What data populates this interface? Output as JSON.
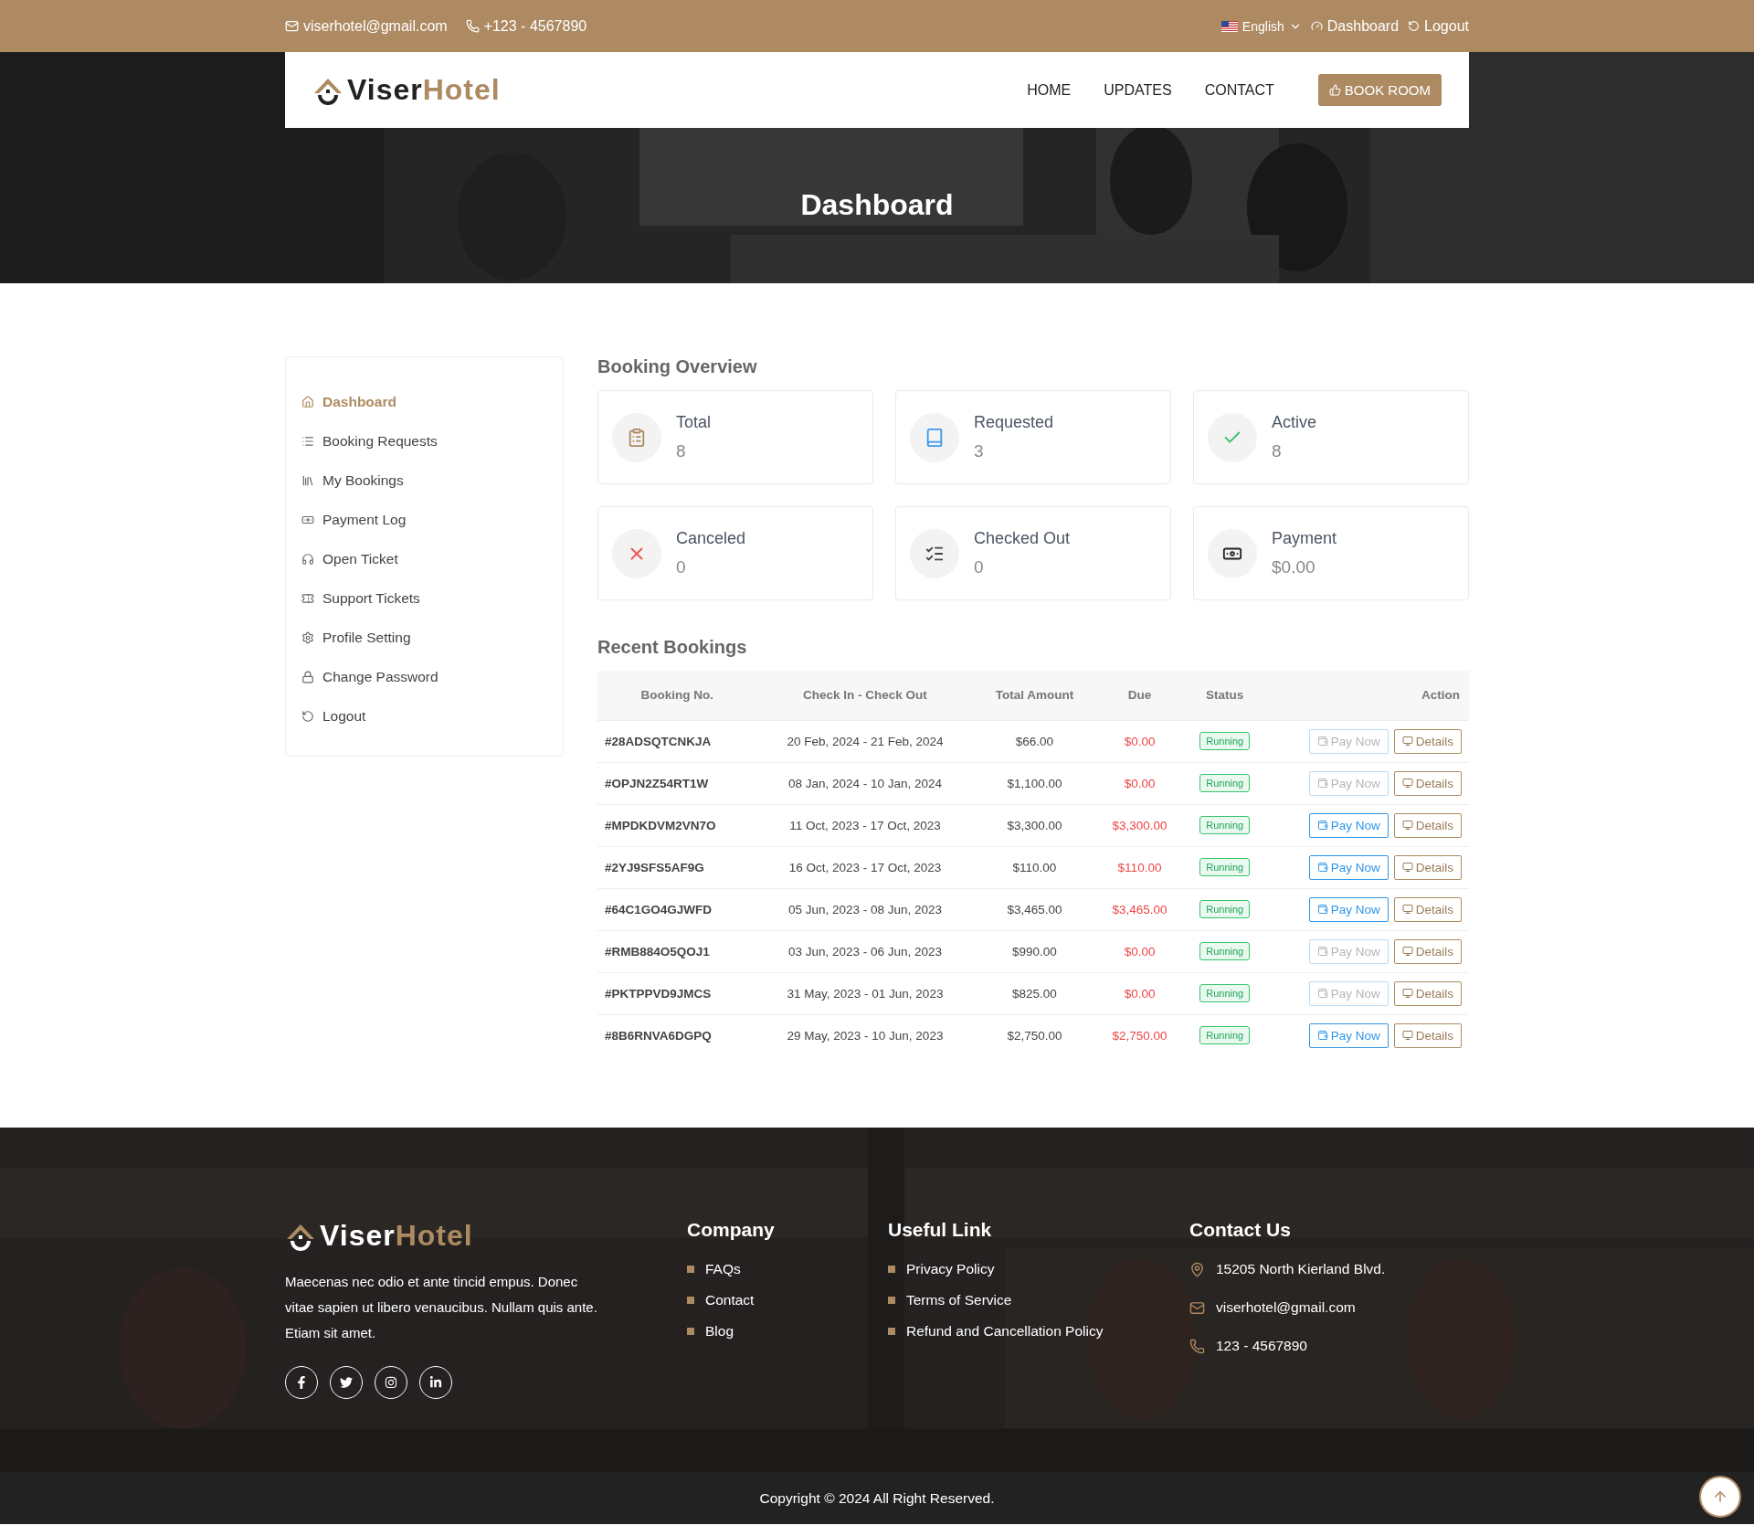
{
  "top_bar": {
    "email": "viserhotel@gmail.com",
    "phone": "+123 - 4567890",
    "language": "English",
    "dashboard_link": "Dashboard",
    "logout_link": "Logout"
  },
  "header": {
    "logo": {
      "first": "Viser",
      "second": "Hotel"
    },
    "nav": [
      "HOME",
      "UPDATES",
      "CONTACT"
    ],
    "book_button": "BOOK ROOM"
  },
  "hero": {
    "title": "Dashboard"
  },
  "sidebar": {
    "items": [
      {
        "label": "Dashboard",
        "selected": true
      },
      {
        "label": "Booking Requests",
        "selected": false
      },
      {
        "label": "My Bookings",
        "selected": false
      },
      {
        "label": "Payment Log",
        "selected": false
      },
      {
        "label": "Open Ticket",
        "selected": false
      },
      {
        "label": "Support Tickets",
        "selected": false
      },
      {
        "label": "Profile Setting",
        "selected": false
      },
      {
        "label": "Change Password",
        "selected": false
      },
      {
        "label": "Logout",
        "selected": false
      }
    ]
  },
  "booking_overview": {
    "title": "Booking Overview",
    "cards": [
      {
        "label": "Total",
        "value": "8"
      },
      {
        "label": "Requested",
        "value": "3"
      },
      {
        "label": "Active",
        "value": "8"
      },
      {
        "label": "Canceled",
        "value": "0"
      },
      {
        "label": "Checked Out",
        "value": "0"
      },
      {
        "label": "Payment",
        "value": "$0.00"
      }
    ]
  },
  "recent_bookings": {
    "title": "Recent Bookings",
    "columns": [
      "Booking No.",
      "Check In - Check Out",
      "Total Amount",
      "Due",
      "Status",
      "Action"
    ],
    "rows": [
      {
        "booking_no": "#28ADSQTCNKJA",
        "dates": "20 Feb, 2024 - 21 Feb, 2024",
        "total": "$66.00",
        "due": "$0.00",
        "status": "Running",
        "pay_button": {
          "label": "Pay Now",
          "disabled": true
        },
        "details_button": "Details"
      },
      {
        "booking_no": "#OPJN2Z54RT1W",
        "dates": "08 Jan, 2024 - 10 Jan, 2024",
        "total": "$1,100.00",
        "due": "$0.00",
        "status": "Running",
        "pay_button": {
          "label": "Pay Now",
          "disabled": true
        },
        "details_button": "Details"
      },
      {
        "booking_no": "#MPDKDVM2VN7O",
        "dates": "11 Oct, 2023 - 17 Oct, 2023",
        "total": "$3,300.00",
        "due": "$3,300.00",
        "status": "Running",
        "pay_button": {
          "label": "Pay Now",
          "disabled": false
        },
        "details_button": "Details"
      },
      {
        "booking_no": "#2YJ9SFS5AF9G",
        "dates": "16 Oct, 2023 - 17 Oct, 2023",
        "total": "$110.00",
        "due": "$110.00",
        "status": "Running",
        "pay_button": {
          "label": "Pay Now",
          "disabled": false
        },
        "details_button": "Details"
      },
      {
        "booking_no": "#64C1GO4GJWFD",
        "dates": "05 Jun, 2023 - 08 Jun, 2023",
        "total": "$3,465.00",
        "due": "$3,465.00",
        "status": "Running",
        "pay_button": {
          "label": "Pay Now",
          "disabled": false
        },
        "details_button": "Details"
      },
      {
        "booking_no": "#RMB884O5QOJ1",
        "dates": "03 Jun, 2023 - 06 Jun, 2023",
        "total": "$990.00",
        "due": "$0.00",
        "status": "Running",
        "pay_button": {
          "label": "Pay Now",
          "disabled": true
        },
        "details_button": "Details"
      },
      {
        "booking_no": "#PKTPPVD9JMCS",
        "dates": "31 May, 2023 - 01 Jun, 2023",
        "total": "$825.00",
        "due": "$0.00",
        "status": "Running",
        "pay_button": {
          "label": "Pay Now",
          "disabled": true
        },
        "details_button": "Details"
      },
      {
        "booking_no": "#8B6RNVA6DGPQ",
        "dates": "29 May, 2023 - 10 Jun, 2023",
        "total": "$2,750.00",
        "due": "$2,750.00",
        "status": "Running",
        "pay_button": {
          "label": "Pay Now",
          "disabled": false
        },
        "details_button": "Details"
      }
    ]
  },
  "footer": {
    "logo": {
      "first": "Viser",
      "second": "Hotel"
    },
    "description": "Maecenas nec odio et ante tincid empus. Donec vitae sapien ut libero venaucibus. Nullam quis ante. Etiam sit amet.",
    "company": {
      "title": "Company",
      "links": [
        "FAQs",
        "Contact",
        "Blog"
      ]
    },
    "useful": {
      "title": "Useful Link",
      "links": [
        "Privacy Policy",
        "Terms of Service",
        "Refund and Cancellation Policy"
      ]
    },
    "contact": {
      "title": "Contact Us",
      "address": "15205 North Kierland Blvd.",
      "email": "viserhotel@gmail.com",
      "phone": "123 - 4567890"
    },
    "copyright": "Copyright © 2024 All Right Reserved."
  }
}
